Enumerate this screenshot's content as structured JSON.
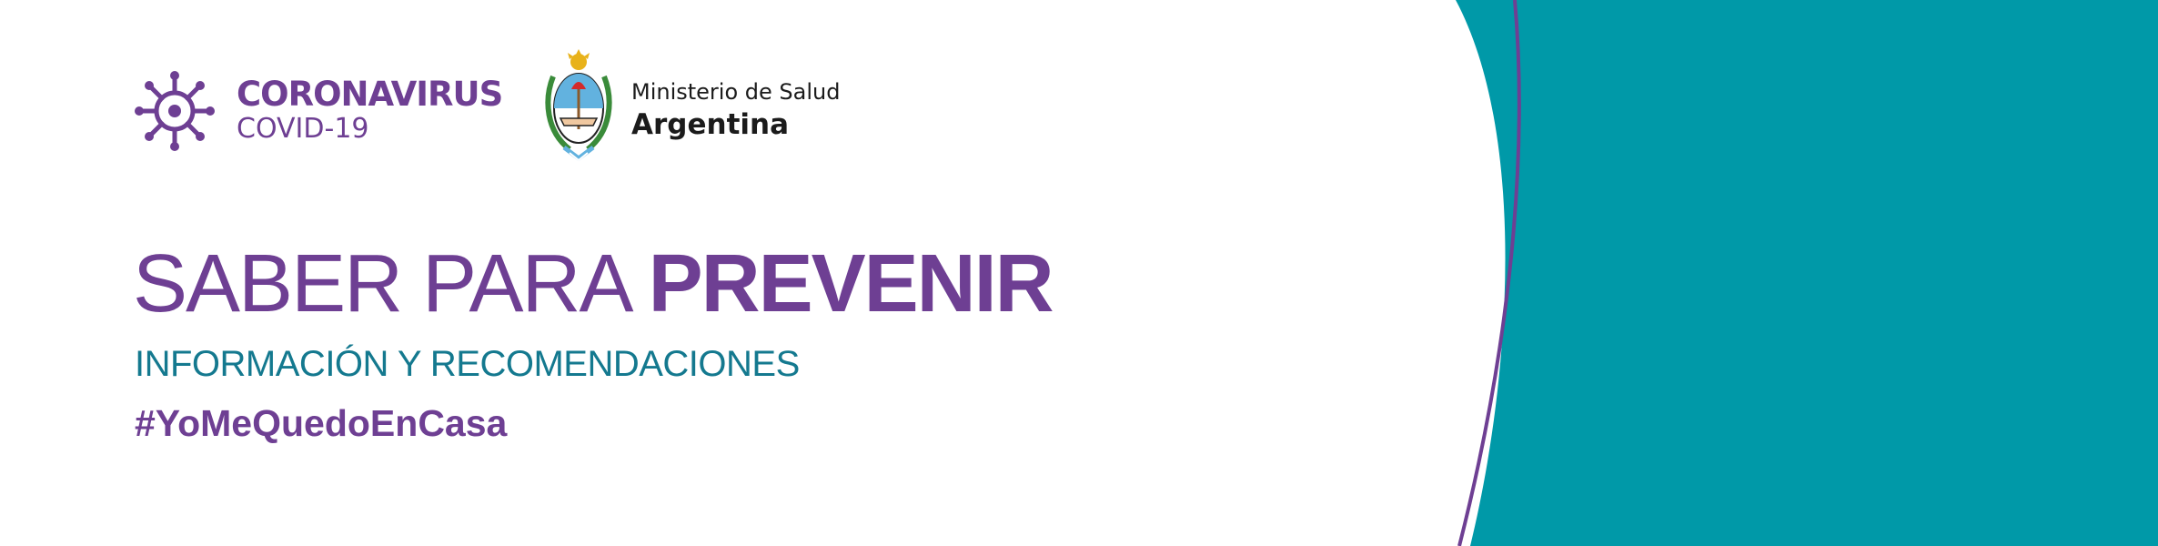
{
  "logo_covid": {
    "title": "CORONAVIRUS",
    "subtitle": "COVID-19",
    "icon": "virus-icon"
  },
  "ministry": {
    "line1": "Ministerio de Salud",
    "line2": "Argentina",
    "icon": "coat-of-arms-icon"
  },
  "headline": {
    "part1": "SABER PARA ",
    "part2": "PREVENIR"
  },
  "subheadline": "INFORMACIÓN Y RECOMENDACIONES",
  "hashtag": "#YoMeQuedoEnCasa",
  "colors": {
    "purple": "#6e3f93",
    "teal": "#0099a8",
    "teal_text": "#14798f",
    "background": "#ffffff"
  }
}
